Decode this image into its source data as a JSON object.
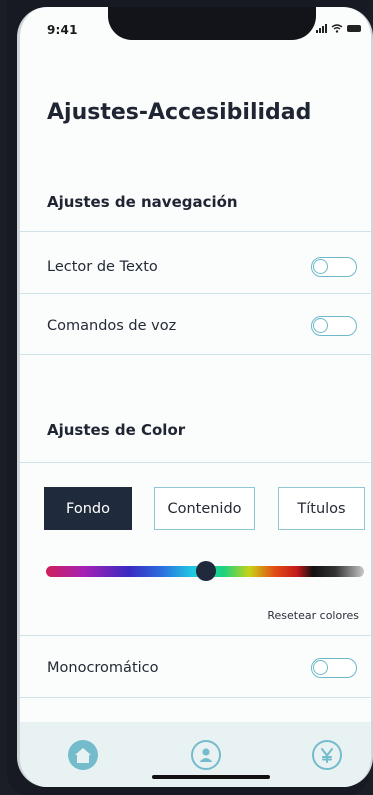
{
  "status_bar": {
    "time": "9:41"
  },
  "page": {
    "title": "Ajustes-Accesibilidad"
  },
  "navigation": {
    "section_title": "Ajustes de navegación",
    "items": [
      {
        "label": "Lector de Texto",
        "enabled": false
      },
      {
        "label": "Comandos de voz",
        "enabled": false
      }
    ]
  },
  "color_settings": {
    "section_title": "Ajustes de Color",
    "segments": [
      {
        "label": "Fondo",
        "selected": true
      },
      {
        "label": "Contenido",
        "selected": false
      },
      {
        "label": "Títulos",
        "selected": false
      }
    ],
    "slider_position": 0.5,
    "reset_label": "Resetear colores"
  },
  "monochrome": {
    "label": "Monocromático",
    "enabled": false
  },
  "tab_bar": {
    "items": [
      {
        "icon": "home-icon",
        "selected": true
      },
      {
        "icon": "user-icon",
        "selected": false
      },
      {
        "icon": "yen-icon",
        "selected": false
      }
    ]
  },
  "colors": {
    "accent": "#6fb8c9",
    "dark": "#1f2b3c",
    "tab_background": "#e9f2f3",
    "divider": "#cfe3e9"
  }
}
